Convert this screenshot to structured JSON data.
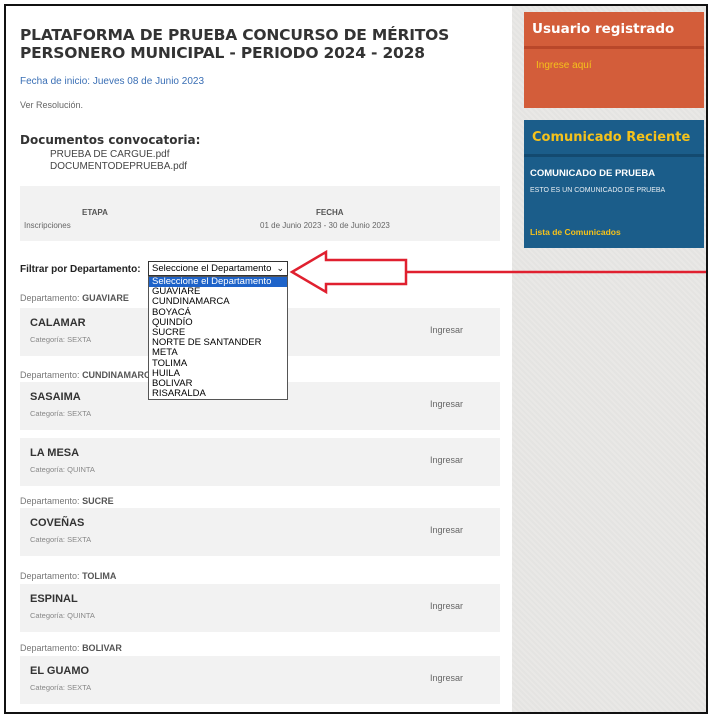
{
  "header": {
    "title": "PLATAFORMA DE PRUEBA CONCURSO DE MÉRITOS PERSONERO MUNICIPAL - PERIODO 2024 - 2028",
    "fecha_inicio": "Fecha de inicio: Jueves 08 de Junio 2023",
    "ver_resolucion": "Ver Resolución."
  },
  "documentos": {
    "title": "Documentos convocatoria:",
    "files": [
      "PRUEBA DE CARGUE.pdf",
      "DOCUMENTODEPRUEBA.pdf"
    ]
  },
  "etapa": {
    "etapa_header": "ETAPA",
    "fecha_header": "FECHA",
    "etapa_value": "Inscripciones",
    "fecha_value": "01 de Junio 2023 - 30 de Junio 2023"
  },
  "filter": {
    "label": "Filtrar por Departamento:",
    "selected": "Seleccione el Departamento",
    "options": [
      "Seleccione el Departamento",
      "GUAVIARE",
      "CUNDINAMARCA",
      "BOYACÁ",
      "QUINDÍO",
      "SUCRE",
      "NORTE DE SANTANDER",
      "META",
      "TOLIMA",
      "HUILA",
      "BOLIVAR",
      "RISARALDA"
    ]
  },
  "dept_prefix": "Departamento:",
  "departments": [
    {
      "name": "GUAVIARE",
      "municipios": [
        {
          "name": "CALAMAR",
          "category": "Categoría: SEXTA",
          "action": "Ingresar"
        }
      ]
    },
    {
      "name": "CUNDINAMARCA",
      "municipios": [
        {
          "name": "SASAIMA",
          "category": "Categoría: SEXTA",
          "action": "Ingresar"
        },
        {
          "name": "LA MESA",
          "category": "Categoría: QUINTA",
          "action": "Ingresar"
        }
      ]
    },
    {
      "name": "SUCRE",
      "municipios": [
        {
          "name": "COVEÑAS",
          "category": "Categoría: SEXTA",
          "action": "Ingresar"
        }
      ]
    },
    {
      "name": "TOLIMA",
      "municipios": [
        {
          "name": "ESPINAL",
          "category": "Categoría: QUINTA",
          "action": "Ingresar"
        }
      ]
    },
    {
      "name": "BOLIVAR",
      "municipios": [
        {
          "name": "EL GUAMO",
          "category": "Categoría: SEXTA",
          "action": "Ingresar"
        }
      ]
    }
  ],
  "sidebar": {
    "usuario": {
      "title": "Usuario registrado",
      "link": "Ingrese aquí"
    },
    "comunicado": {
      "title": "Comunicado Reciente",
      "item_title": "COMUNICADO DE PRUEBA",
      "item_body": "ESTO ES UN COMUNICADO DE PRUEBA",
      "link": "Lista de Comunicados"
    }
  },
  "annotation": {
    "arrow_color": "#e0202f"
  },
  "colors": {
    "orange_panel": "#d35d3a",
    "blue_panel": "#1b5d8a",
    "accent_yellow": "#f5c21b",
    "link_blue": "#3a6fb5",
    "selected_option": "#1e63c9"
  }
}
